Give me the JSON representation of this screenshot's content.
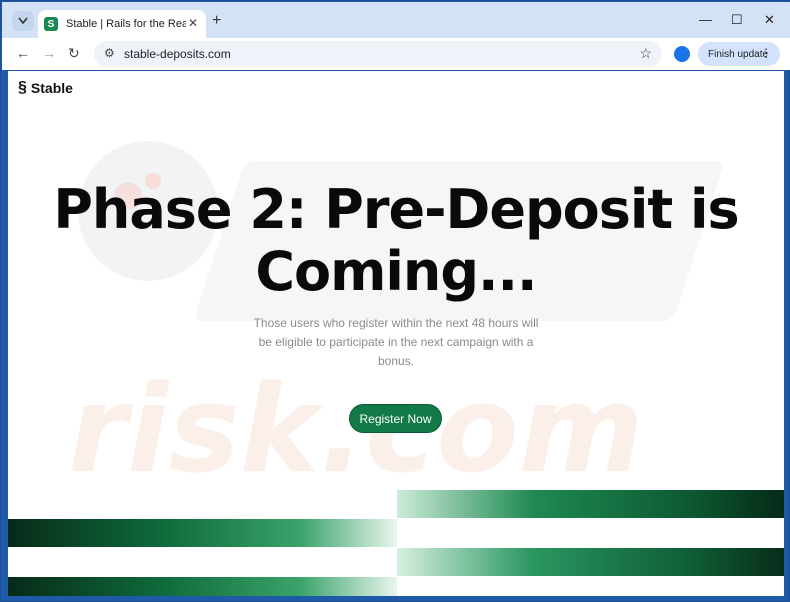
{
  "browser": {
    "tab_title": "Stable | Rails for the Real World",
    "favicon_letter": "S",
    "url": "stable-deposits.com",
    "update_label": "Finish update"
  },
  "page": {
    "brand_name": "Stable",
    "headline": "Phase 2: Pre-Deposit is Coming...",
    "subtext": "Those users who register within the next 48 hours will be eligible to participate in the next campaign with a bonus.",
    "cta_label": "Register Now"
  },
  "colors": {
    "accent": "#127a46",
    "stripe_dark": "#0a3d22",
    "frame": "#1f5aa8"
  }
}
